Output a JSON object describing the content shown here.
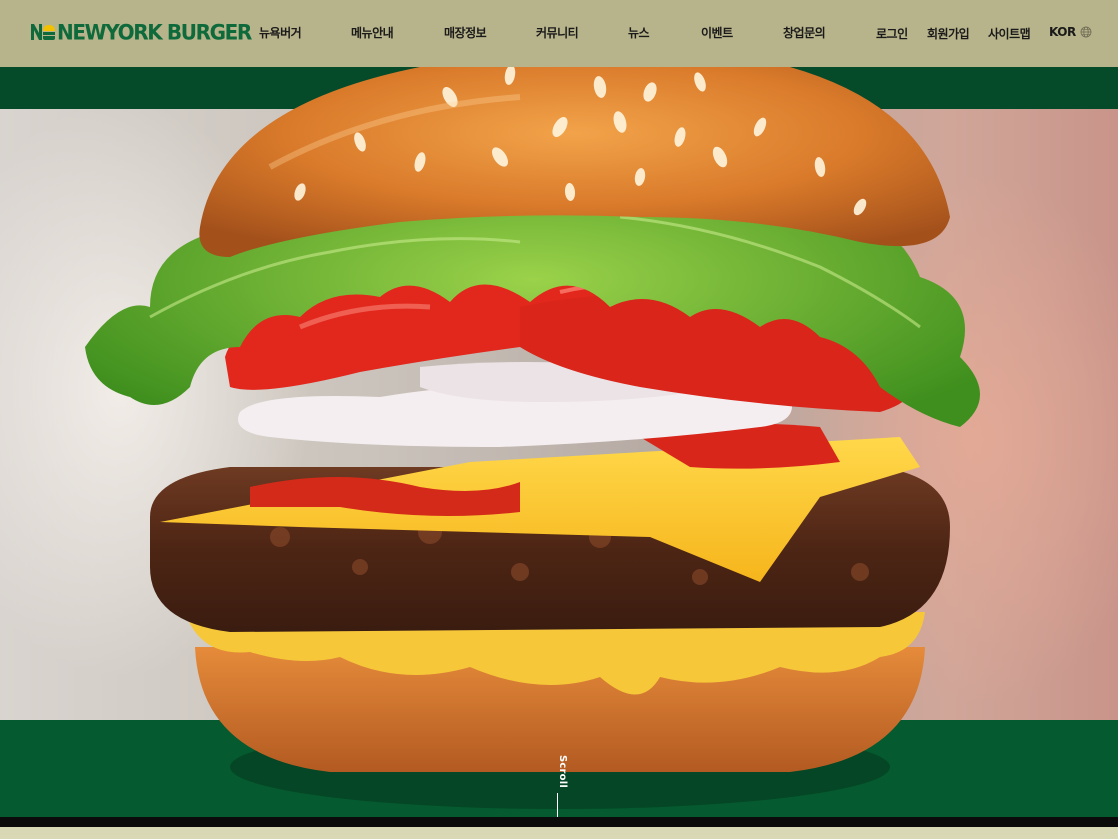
{
  "brand": {
    "logo_text": "NEWYORK BURGER",
    "logo_color": "#0e6a3a"
  },
  "nav": {
    "items": [
      "뉴욕버거",
      "메뉴안내",
      "매장정보",
      "커뮤니티",
      "뉴스",
      "이벤트",
      "창업문의"
    ]
  },
  "utility": {
    "login": "로그인",
    "signup": "회원가입",
    "sitemap": "사이트맵",
    "language": "KOR",
    "language_icon": "globe-icon"
  },
  "hero": {
    "scroll_label": "Scroll",
    "band_color": "#055a2f"
  },
  "colors": {
    "header_bg": "#b7b38a",
    "accent_green": "#054a29"
  }
}
